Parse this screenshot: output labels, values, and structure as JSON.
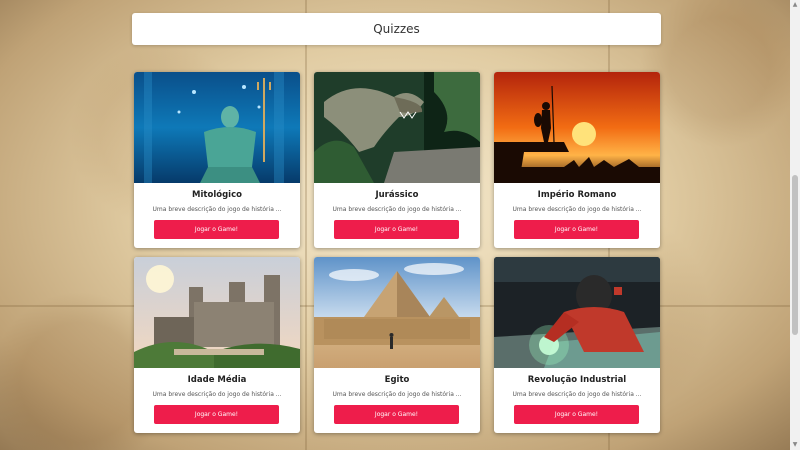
{
  "header": {
    "title": "Quizzes"
  },
  "cards": [
    {
      "title": "Mitológico",
      "description": "Uma breve descrição do jogo de história ...",
      "button": "Jogar o Game!"
    },
    {
      "title": "Jurássico",
      "description": "Uma breve descrição do jogo de história ...",
      "button": "Jogar o Game!"
    },
    {
      "title": "Império Romano",
      "description": "Uma breve descrição do jogo de história ...",
      "button": "Jogar o Game!"
    },
    {
      "title": "Idade Média",
      "description": "Uma breve descrição do jogo de história ...",
      "button": "Jogar o Game!"
    },
    {
      "title": "Egito",
      "description": "Uma breve descrição do jogo de história ...",
      "button": "Jogar o Game!"
    },
    {
      "title": "Revolução Industrial",
      "description": "Uma breve descrição do jogo de história ...",
      "button": "Jogar o Game!"
    }
  ],
  "colors": {
    "button": "#ee1d4b",
    "card": "#ffffff",
    "parchment": "#d9c398"
  }
}
